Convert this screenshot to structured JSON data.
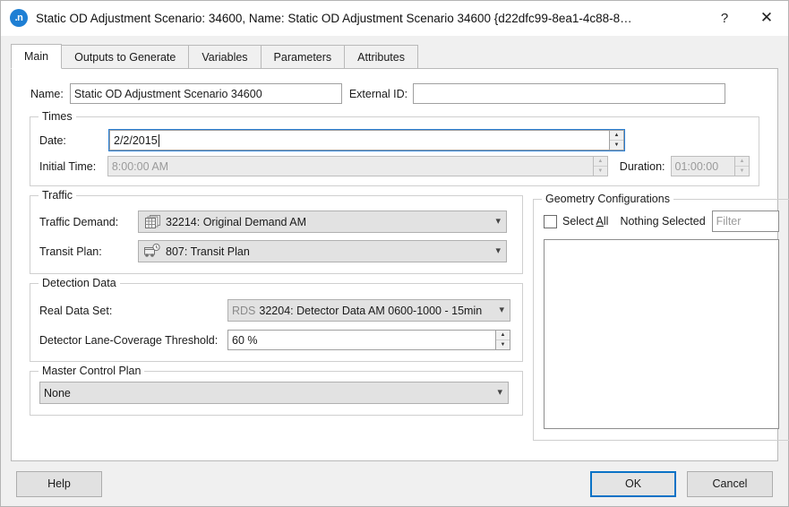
{
  "window": {
    "icon_label": ".n",
    "title": "Static OD Adjustment Scenario: 34600, Name: Static OD Adjustment Scenario 34600  {d22dfc99-8ea1-4c88-8…",
    "help_glyph": "?",
    "close_glyph": "✕"
  },
  "tabs": [
    {
      "label": "Main",
      "active": true
    },
    {
      "label": "Outputs to Generate",
      "active": false
    },
    {
      "label": "Variables",
      "active": false
    },
    {
      "label": "Parameters",
      "active": false
    },
    {
      "label": "Attributes",
      "active": false
    }
  ],
  "main": {
    "name_label": "Name:",
    "name_value": "Static OD Adjustment Scenario 34600",
    "external_id_label": "External ID:",
    "external_id_value": "",
    "times": {
      "title": "Times",
      "date_label": "Date:",
      "date_value": "2/2/2015",
      "initial_time_label": "Initial Time:",
      "initial_time_value": "8:00:00 AM",
      "duration_label": "Duration:",
      "duration_value": "01:00:00"
    },
    "traffic": {
      "title": "Traffic",
      "demand_label": "Traffic Demand:",
      "demand_value": "32214: Original Demand AM",
      "demand_icon": "matrix-stack-icon",
      "transit_label": "Transit Plan:",
      "transit_value": "807: Transit Plan",
      "transit_icon": "bus-clock-icon"
    },
    "detection": {
      "title": "Detection Data",
      "real_data_set_label": "Real Data Set:",
      "real_data_set_prefix": "RDS",
      "real_data_set_value": "32204: Detector Data AM 0600-1000 - 15min",
      "threshold_label": "Detector Lane-Coverage Threshold:",
      "threshold_value": "60 %"
    },
    "master_control": {
      "title": "Master Control Plan",
      "value": "None"
    },
    "geometry": {
      "title": "Geometry Configurations",
      "select_all_label": "Select All",
      "select_all_mnemonic": "A",
      "status_label": "Nothing Selected",
      "filter_placeholder": "Filter",
      "filter_value": "",
      "checked": false,
      "items": []
    }
  },
  "footer": {
    "help_label": "Help",
    "ok_label": "OK",
    "cancel_label": "Cancel"
  },
  "colors": {
    "accent": "#0a72c6",
    "title_icon": "#1e7fd4",
    "panel_bg": "#ffffff",
    "window_bg": "#f0f0f0"
  }
}
